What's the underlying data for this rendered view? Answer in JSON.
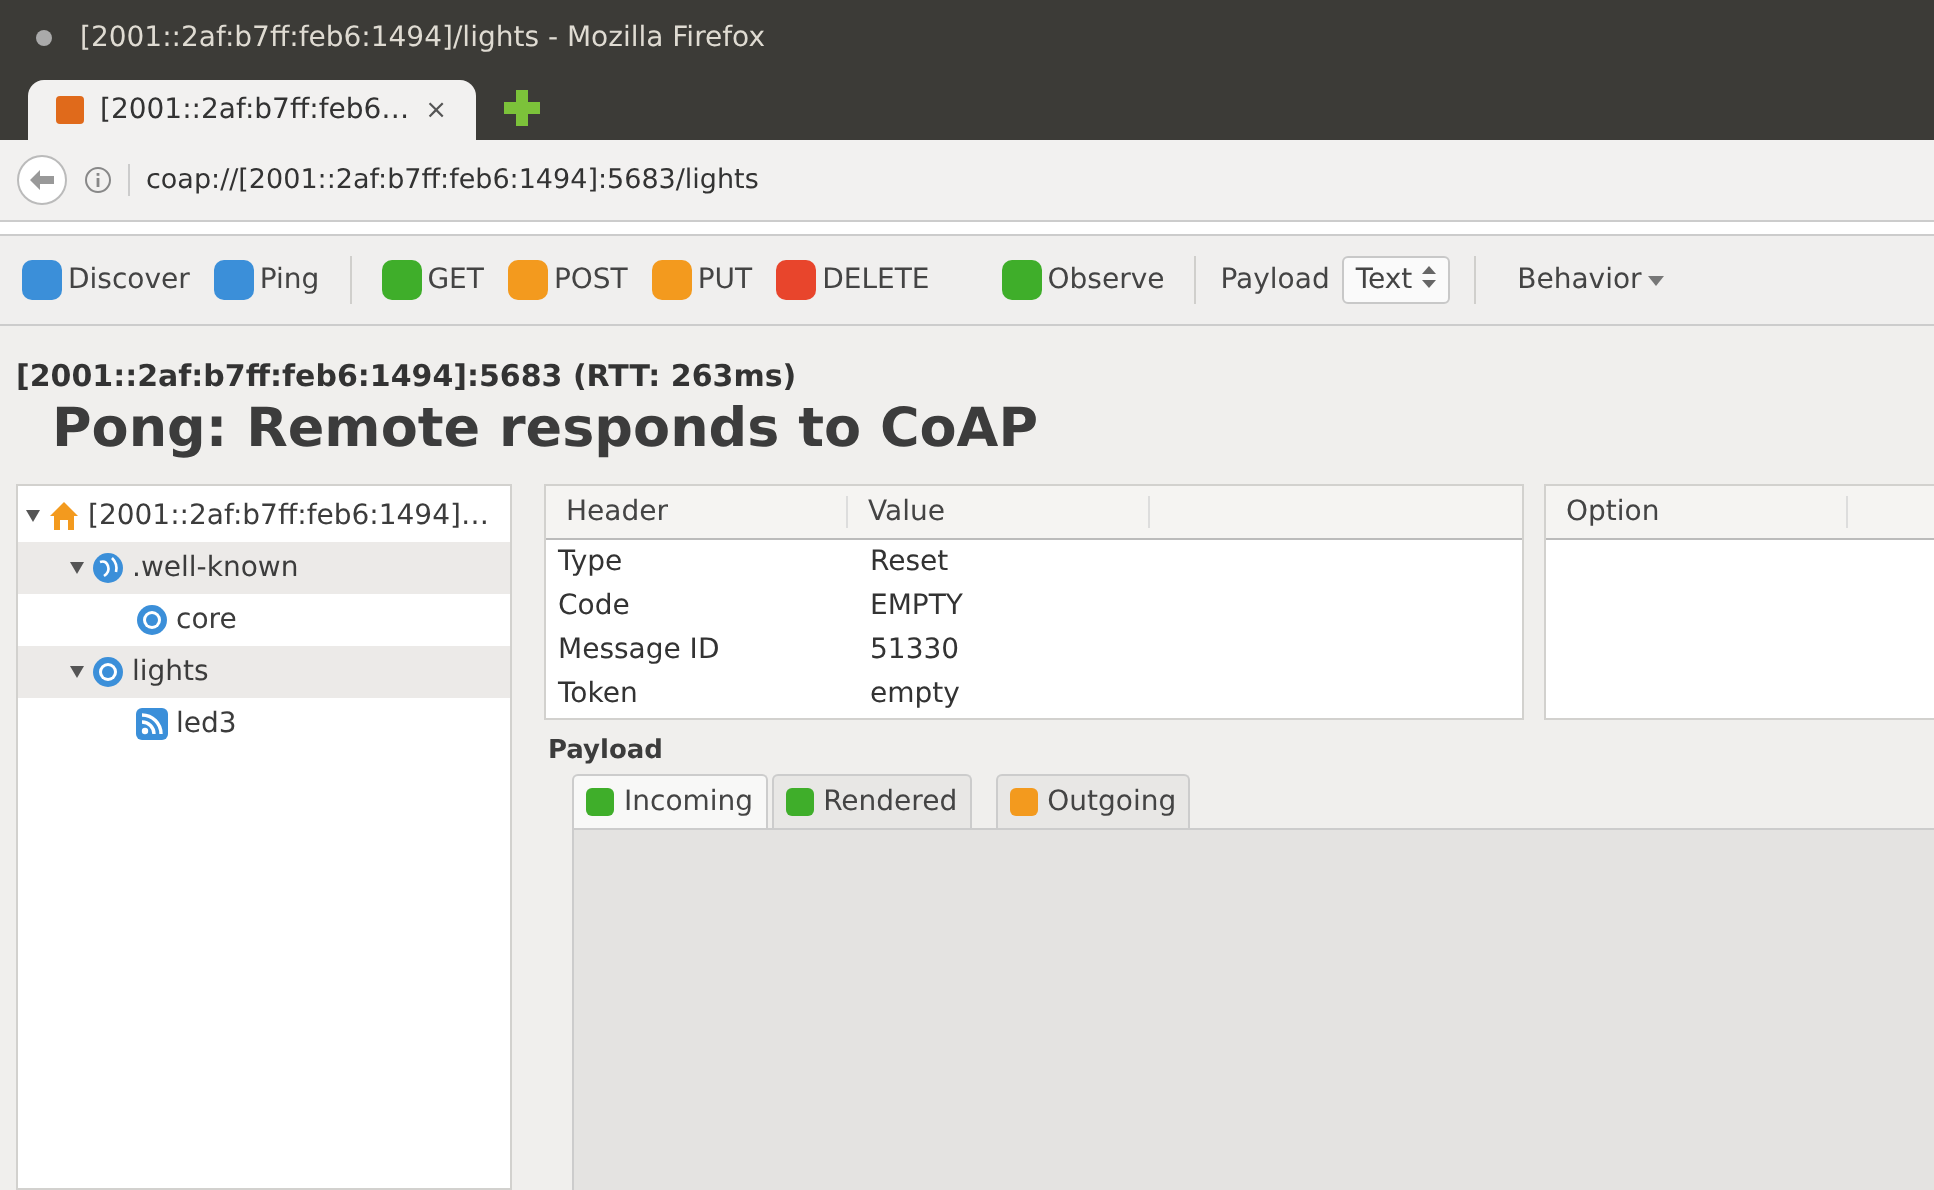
{
  "window": {
    "title": "[2001::2af:b7ff:feb6:1494]/lights - Mozilla Firefox"
  },
  "browser_tabs": [
    {
      "label": "[2001::2af:b7ff:feb6…",
      "close": "×",
      "selected": true
    }
  ],
  "address_bar": {
    "url": "coap://[2001::2af:b7ff:feb6:1494]:5683/lights"
  },
  "toolbar": [
    {
      "kind": "button",
      "label": "Discover"
    },
    {
      "kind": "button",
      "label": "Ping"
    },
    {
      "kind": "separator"
    },
    {
      "kind": "button",
      "label": "GET"
    },
    {
      "kind": "button",
      "label": "POST"
    },
    {
      "kind": "button",
      "label": "PUT"
    },
    {
      "kind": "button",
      "label": "DELETE"
    },
    {
      "kind": "spacer"
    },
    {
      "kind": "button",
      "label": "Observe"
    },
    {
      "kind": "separator"
    },
    {
      "kind": "label",
      "label": "Payload"
    },
    {
      "kind": "select",
      "label": "Text"
    },
    {
      "kind": "separator"
    },
    {
      "kind": "menu",
      "label": "Behavior"
    }
  ],
  "status": {
    "endpoint": "[2001::2af:b7ff:feb6:1494]:5683 (RTT: 263ms)",
    "message": "Pong: Remote responds to CoAP"
  },
  "tree": [
    {
      "label": "[2001::2af:b7ff:feb6:1494]…",
      "kind": "host",
      "expanded": true,
      "children": [
        {
          "label": ".well-known",
          "kind": "globe",
          "expanded": true,
          "children": [
            {
              "label": "core",
              "kind": "resource"
            }
          ]
        },
        {
          "label": "lights",
          "kind": "resource",
          "expanded": true,
          "children": [
            {
              "label": "led3",
              "kind": "observable"
            }
          ]
        }
      ]
    }
  ],
  "headers_table": {
    "columns": [
      "Header",
      "Value"
    ],
    "rows": [
      [
        "Type",
        "Reset"
      ],
      [
        "Code",
        "EMPTY"
      ],
      [
        "Message ID",
        "51330"
      ],
      [
        "Token",
        "empty"
      ]
    ]
  },
  "options_table": {
    "columns": [
      "Option"
    ]
  },
  "payload": {
    "title": "Payload",
    "tabs": [
      {
        "label": "Incoming",
        "selected": true
      },
      {
        "label": "Rendered",
        "selected": false
      },
      {
        "label": "Outgoing",
        "selected": false
      }
    ]
  }
}
